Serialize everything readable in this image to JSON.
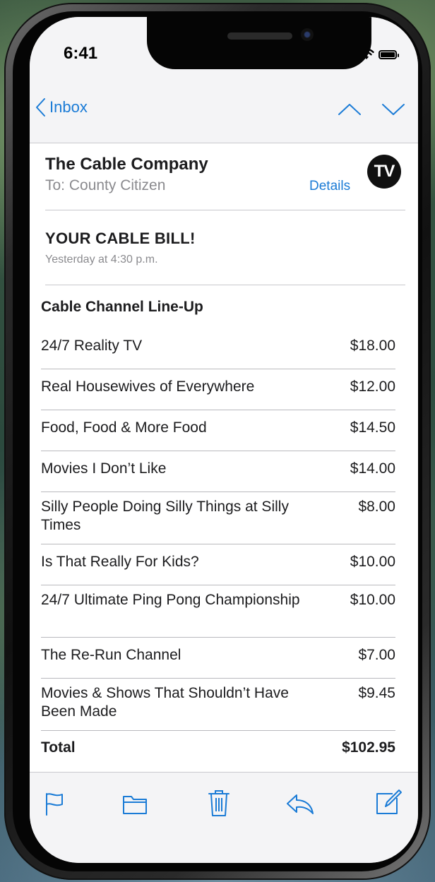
{
  "status": {
    "time": "6:41"
  },
  "nav": {
    "back_label": "Inbox"
  },
  "email": {
    "sender": "The Cable Company",
    "to": "To: County Citizen",
    "details_label": "Details",
    "avatar_text": "TV",
    "subject": "YOUR CABLE BILL!",
    "date": "Yesterday at 4:30 p.m.",
    "section_title": "Cable Channel Line-Up",
    "rows": [
      {
        "name": "24/7 Reality TV",
        "price": "$18.00"
      },
      {
        "name": "Real Housewives of Everywhere",
        "price": "$12.00"
      },
      {
        "name": "Food, Food & More Food",
        "price": "$14.50"
      },
      {
        "name": "Movies I Don’t Like",
        "price": "$14.00"
      },
      {
        "name": "Silly People Doing Silly Things at Silly Times",
        "price": "$8.00"
      },
      {
        "name": "Is That Really For Kids?",
        "price": "$10.00"
      },
      {
        "name": "24/7 Ultimate Ping Pong Championship",
        "price": "$10.00"
      },
      {
        "name": "The Re-Run Channel",
        "price": "$7.00"
      },
      {
        "name": "Movies & Shows That Shouldn’t Have Been Made",
        "price": "$9.45"
      }
    ],
    "total_label": "Total",
    "total_value": "$102.95"
  },
  "colors": {
    "accent": "#1a7bd6",
    "bar_bg": "#f4f4f6",
    "text": "#1c1c1e",
    "secondary": "#8a8a8e"
  },
  "icons": [
    "flag-icon",
    "folder-icon",
    "trash-icon",
    "reply-icon",
    "compose-icon"
  ]
}
